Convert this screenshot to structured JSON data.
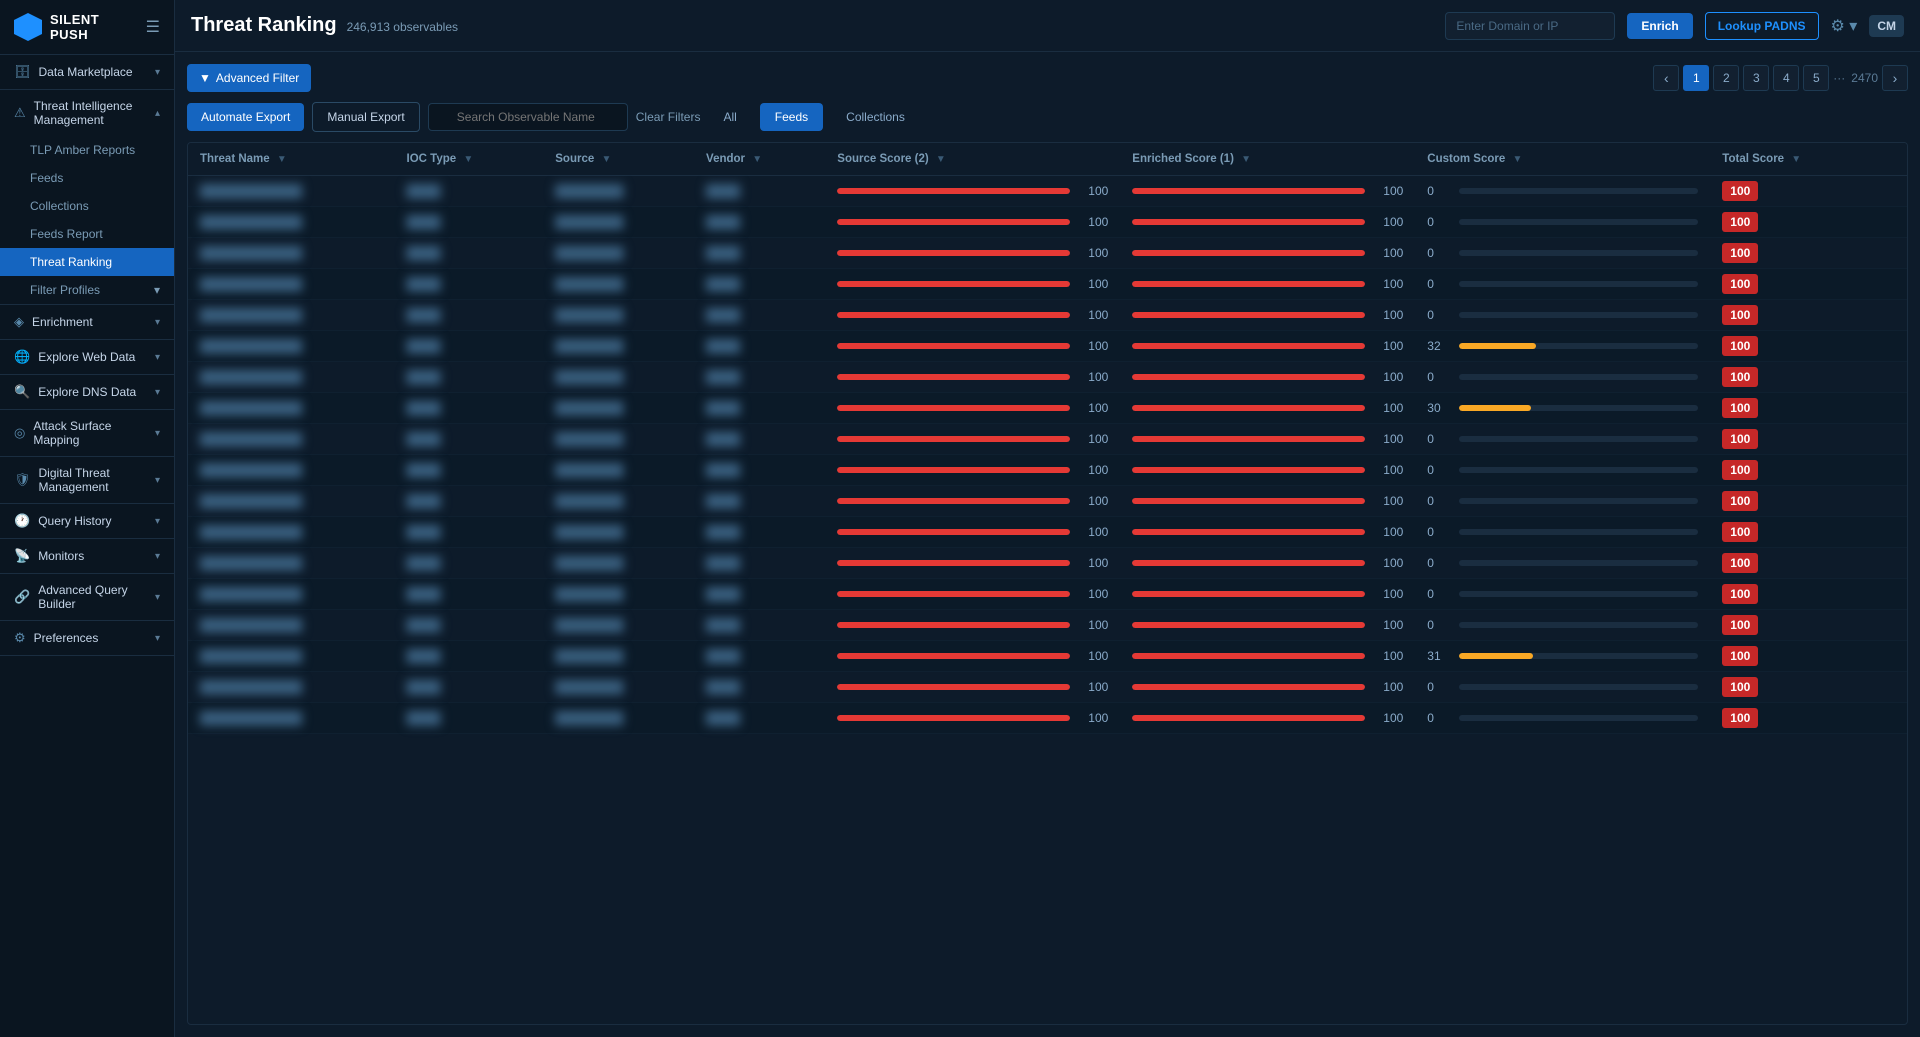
{
  "app": {
    "logo_text": "SILENT PUsh",
    "hamburger": "☰"
  },
  "sidebar": {
    "sections": [
      {
        "type": "top-level",
        "items": [
          {
            "id": "data-marketplace",
            "label": "Data Marketplace",
            "icon": "🗄",
            "chevron": true,
            "active": false
          }
        ]
      },
      {
        "type": "group",
        "items": [
          {
            "id": "threat-intelligence",
            "label": "Threat Intelligence Management",
            "icon": "⚠",
            "chevron": true,
            "active": false,
            "expanded": true
          },
          {
            "id": "tlp-amber",
            "label": "TLP Amber Reports",
            "icon": "",
            "sub": true,
            "badge": true
          },
          {
            "id": "feeds",
            "label": "Feeds",
            "icon": "",
            "sub": true
          },
          {
            "id": "collections",
            "label": "Collections",
            "icon": "",
            "sub": true
          },
          {
            "id": "feeds-report",
            "label": "Feeds Report",
            "icon": "",
            "sub": true
          },
          {
            "id": "threat-ranking",
            "label": "Threat Ranking",
            "icon": "",
            "sub": true,
            "active": true
          },
          {
            "id": "filter-profiles",
            "label": "Filter Profiles",
            "icon": "",
            "sub": true,
            "chevron": true
          }
        ]
      },
      {
        "type": "group",
        "items": [
          {
            "id": "enrichment",
            "label": "Enrichment",
            "icon": "◈",
            "chevron": true
          }
        ]
      },
      {
        "type": "group",
        "items": [
          {
            "id": "explore-web",
            "label": "Explore Web Data",
            "icon": "🌐",
            "chevron": true
          }
        ]
      },
      {
        "type": "group",
        "items": [
          {
            "id": "explore-dns",
            "label": "Explore DNS Data",
            "icon": "🔍",
            "chevron": true
          }
        ]
      },
      {
        "type": "group",
        "items": [
          {
            "id": "attack-surface",
            "label": "Attack Surface Mapping",
            "icon": "◎",
            "chevron": true
          }
        ]
      },
      {
        "type": "group",
        "items": [
          {
            "id": "digital-threat",
            "label": "Digital Threat Management",
            "icon": "🛡",
            "chevron": true
          }
        ]
      },
      {
        "type": "group",
        "items": [
          {
            "id": "query-history",
            "label": "Query History",
            "icon": "🕐",
            "chevron": true
          }
        ]
      },
      {
        "type": "group",
        "items": [
          {
            "id": "monitors",
            "label": "Monitors",
            "icon": "📡",
            "chevron": true
          }
        ]
      },
      {
        "type": "group",
        "items": [
          {
            "id": "advanced-query",
            "label": "Advanced Query Builder",
            "icon": "🔗",
            "chevron": true
          }
        ]
      },
      {
        "type": "group",
        "items": [
          {
            "id": "preferences",
            "label": "Preferences",
            "icon": "⚙",
            "chevron": true
          }
        ]
      }
    ]
  },
  "topbar": {
    "title": "Threat Ranking",
    "observables": "246,913 observables",
    "domain_placeholder": "Enter Domain or IP",
    "btn_enrich": "Enrich",
    "btn_lookup": "Lookup PADNS",
    "user": "CM"
  },
  "toolbar": {
    "btn_advanced_filter": "Advanced Filter",
    "btn_automate_export": "Automate Export",
    "btn_manual_export": "Manual Export",
    "search_placeholder": "Search Observable Name",
    "btn_clear_filters": "Clear Filters",
    "tabs": [
      "All",
      "Feeds",
      "Collections"
    ],
    "active_tab": "Feeds"
  },
  "pagination": {
    "pages": [
      "1",
      "2",
      "3",
      "4",
      "5"
    ],
    "active": "1",
    "total": "2470",
    "prev": "‹",
    "next": "›",
    "dots": "···"
  },
  "table": {
    "columns": [
      {
        "id": "threat-name",
        "label": "Threat Name"
      },
      {
        "id": "ioc-type",
        "label": "IOC Type"
      },
      {
        "id": "source",
        "label": "Source"
      },
      {
        "id": "vendor",
        "label": "Vendor"
      },
      {
        "id": "source-score",
        "label": "Source Score (2)"
      },
      {
        "id": "enriched-score",
        "label": "Enriched Score (1)"
      },
      {
        "id": "custom-score",
        "label": "Custom Score"
      },
      {
        "id": "total-score",
        "label": "Total Score"
      }
    ],
    "rows": [
      {
        "source_score": 100,
        "enriched_score": 100,
        "custom_score": 0,
        "custom_pct": 0,
        "custom_color": "grey-bar",
        "total": "100"
      },
      {
        "source_score": 100,
        "enriched_score": 100,
        "custom_score": 0,
        "custom_pct": 0,
        "custom_color": "grey-bar",
        "total": "100"
      },
      {
        "source_score": 100,
        "enriched_score": 100,
        "custom_score": 0,
        "custom_pct": 0,
        "custom_color": "grey-bar",
        "total": "100"
      },
      {
        "source_score": 100,
        "enriched_score": 100,
        "custom_score": 0,
        "custom_pct": 0,
        "custom_color": "grey-bar",
        "total": "100"
      },
      {
        "source_score": 100,
        "enriched_score": 100,
        "custom_score": 0,
        "custom_pct": 0,
        "custom_color": "grey-bar",
        "total": "100"
      },
      {
        "source_score": 100,
        "enriched_score": 100,
        "custom_score": 32,
        "custom_pct": 32,
        "custom_color": "yellow",
        "total": "100"
      },
      {
        "source_score": 100,
        "enriched_score": 100,
        "custom_score": 0,
        "custom_pct": 0,
        "custom_color": "grey-bar",
        "total": "100"
      },
      {
        "source_score": 100,
        "enriched_score": 100,
        "custom_score": 30,
        "custom_pct": 30,
        "custom_color": "yellow",
        "total": "100"
      },
      {
        "source_score": 100,
        "enriched_score": 100,
        "custom_score": 0,
        "custom_pct": 0,
        "custom_color": "grey-bar",
        "total": "100"
      },
      {
        "source_score": 100,
        "enriched_score": 100,
        "custom_score": 0,
        "custom_pct": 0,
        "custom_color": "grey-bar",
        "total": "100"
      },
      {
        "source_score": 100,
        "enriched_score": 100,
        "custom_score": 0,
        "custom_pct": 0,
        "custom_color": "grey-bar",
        "total": "100"
      },
      {
        "source_score": 100,
        "enriched_score": 100,
        "custom_score": 0,
        "custom_pct": 0,
        "custom_color": "grey-bar",
        "total": "100"
      },
      {
        "source_score": 100,
        "enriched_score": 100,
        "custom_score": 0,
        "custom_pct": 0,
        "custom_color": "grey-bar",
        "total": "100"
      },
      {
        "source_score": 100,
        "enriched_score": 100,
        "custom_score": 0,
        "custom_pct": 0,
        "custom_color": "grey-bar",
        "total": "100"
      },
      {
        "source_score": 100,
        "enriched_score": 100,
        "custom_score": 0,
        "custom_pct": 0,
        "custom_color": "grey-bar",
        "total": "100"
      },
      {
        "source_score": 100,
        "enriched_score": 100,
        "custom_score": 31,
        "custom_pct": 31,
        "custom_color": "yellow",
        "total": "100"
      },
      {
        "source_score": 100,
        "enriched_score": 100,
        "custom_score": 0,
        "custom_pct": 0,
        "custom_color": "grey-bar",
        "total": "100"
      },
      {
        "source_score": 100,
        "enriched_score": 100,
        "custom_score": 0,
        "custom_pct": 0,
        "custom_color": "grey-bar",
        "total": "100"
      }
    ]
  }
}
